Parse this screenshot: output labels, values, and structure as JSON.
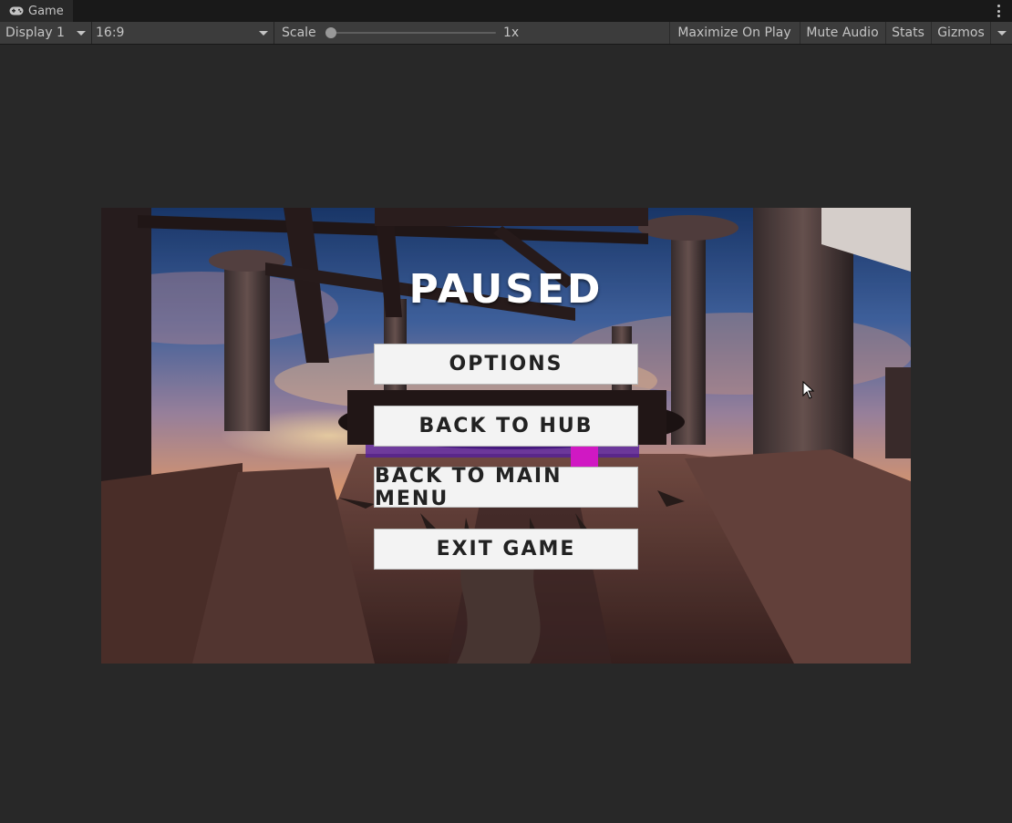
{
  "window": {
    "tab_title": "Game",
    "tab_icon": "gamepad-icon",
    "menu_icon": "kebab-menu-icon"
  },
  "toolbar": {
    "display": "Display 1",
    "aspect": "16:9",
    "scale_label": "Scale",
    "scale_value": "1x",
    "maximize_on_play": "Maximize On Play",
    "mute_audio": "Mute Audio",
    "stats": "Stats",
    "gizmos": "Gizmos"
  },
  "game": {
    "title": "PAUSED",
    "buttons": [
      "OPTIONS",
      "BACK TO HUB",
      "BACK TO MAIN MENU",
      "EXIT GAME"
    ]
  },
  "colors": {
    "editor_bg": "#282828",
    "toolbar_bg": "#3c3c3c",
    "button_bg": "#f3f3f3",
    "button_text": "#222222",
    "title_text": "#ffffff"
  }
}
